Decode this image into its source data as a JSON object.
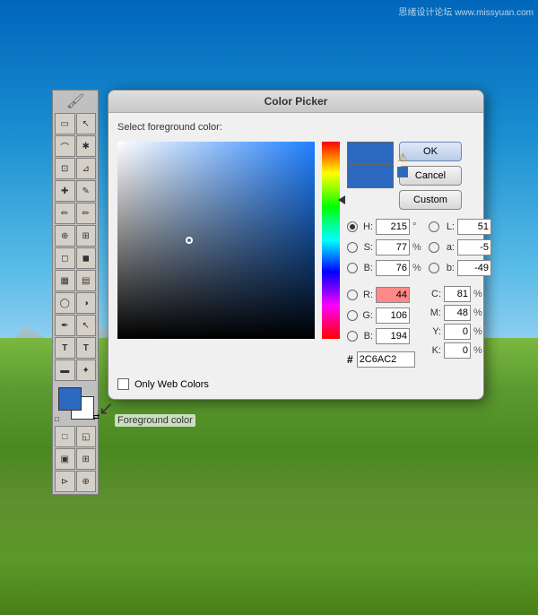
{
  "app": {
    "watermark": "思绪设计论坛 www.missyuan.com"
  },
  "dialog": {
    "title": "Color Picker",
    "label": "Select foreground color:",
    "ok_button": "OK",
    "cancel_button": "Cancel",
    "custom_button": "Custom",
    "only_web_colors": "Only Web Colors",
    "hex_value": "2C6AC2",
    "h_label": "H:",
    "h_value": "215",
    "h_unit": "°",
    "s_label": "S:",
    "s_value": "77",
    "s_unit": "%",
    "b_label": "B:",
    "b_value": "76",
    "b_unit": "%",
    "r_label": "R:",
    "r_value": "44",
    "g_label": "G:",
    "g_value": "106",
    "b2_label": "B:",
    "b2_value": "194",
    "l_label": "L:",
    "l_value": "51",
    "a_label": "a:",
    "a_value": "-5",
    "b3_label": "b:",
    "b3_value": "-49",
    "c_label": "C:",
    "c_value": "81",
    "c_unit": "%",
    "m_label": "M:",
    "m_value": "48",
    "m_unit": "%",
    "y_label": "Y:",
    "y_value": "0",
    "y_unit": "%",
    "k_label": "K:",
    "k_value": "0",
    "k_unit": "%",
    "hash": "#",
    "fg_label": "Foreground color",
    "color": "#2C6AC2"
  },
  "toolbar": {
    "tools": [
      {
        "id": "marquee-rect",
        "icon": "▭"
      },
      {
        "id": "marquee-lasso",
        "icon": "⌑"
      },
      {
        "id": "crop",
        "icon": "⊡"
      },
      {
        "id": "heal",
        "icon": "✚"
      },
      {
        "id": "brush",
        "icon": "✏"
      },
      {
        "id": "stamp",
        "icon": "⊕"
      },
      {
        "id": "eraser",
        "icon": "◻"
      },
      {
        "id": "gradient",
        "icon": "▦"
      },
      {
        "id": "dodge",
        "icon": "◯"
      },
      {
        "id": "path",
        "icon": "✒"
      },
      {
        "id": "text",
        "icon": "T"
      },
      {
        "id": "shape",
        "icon": "▬"
      },
      {
        "id": "select",
        "icon": "↖"
      },
      {
        "id": "hand",
        "icon": "✋"
      },
      {
        "id": "zoom",
        "icon": "⊕"
      }
    ]
  }
}
